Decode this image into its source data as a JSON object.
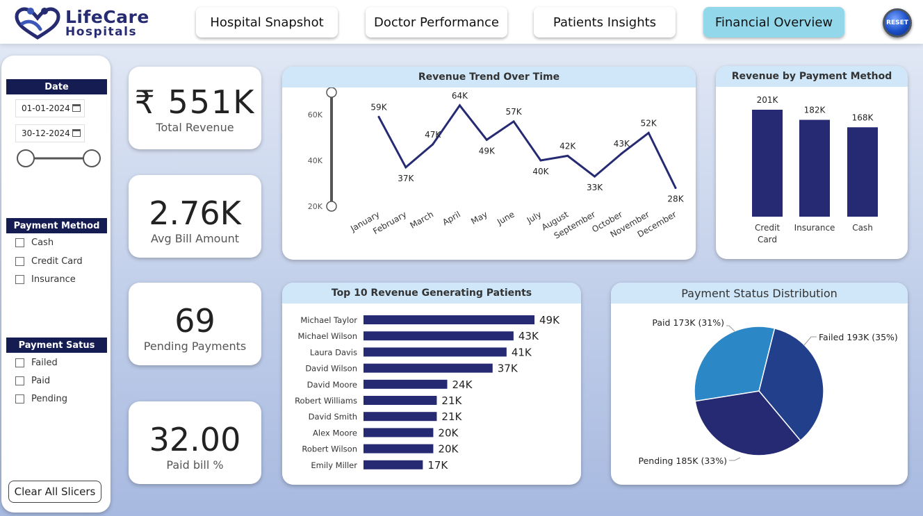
{
  "logo": {
    "line1": "LifeCare",
    "line2": "Hospitals"
  },
  "nav": [
    {
      "label": "Hospital Snapshot",
      "active": false
    },
    {
      "label": "Doctor Performance",
      "active": false
    },
    {
      "label": "Patients Insights",
      "active": false
    },
    {
      "label": "Financial Overview",
      "active": true
    }
  ],
  "reset_label": "RESET",
  "slicers": {
    "date": {
      "title": "Date",
      "start": "01-01-2024",
      "end": "30-12-2024"
    },
    "payment_method": {
      "title": "Payment Method",
      "options": [
        "Cash",
        "Credit Card",
        "Insurance"
      ]
    },
    "payment_status": {
      "title": "Payment Satus",
      "options": [
        "Failed",
        "Paid",
        "Pending"
      ]
    },
    "clear_label": "Clear All Slicers"
  },
  "kpis": [
    {
      "value": "₹ 551K",
      "label": "Total Revenue"
    },
    {
      "value": "2.76K",
      "label": "Avg Bill Amount"
    },
    {
      "value": "69",
      "label": "Pending Payments"
    },
    {
      "value": "32.00",
      "label": "Paid bill %"
    }
  ],
  "colors": {
    "navy": "#252a72",
    "slicer_header": "#141c52",
    "card_header": "#cfe7f8",
    "active_tab": "#93d8ea",
    "pie": [
      "#223f8c",
      "#252a72",
      "#2c87c6"
    ]
  },
  "chart_data": [
    {
      "type": "line",
      "title": "Revenue Trend Over Time",
      "categories": [
        "January",
        "February",
        "March",
        "April",
        "May",
        "June",
        "July",
        "August",
        "September",
        "October",
        "November",
        "December"
      ],
      "values": [
        59,
        37,
        47,
        64,
        49,
        57,
        40,
        42,
        33,
        43,
        52,
        28
      ],
      "labels": [
        "59K",
        "37K",
        "47K",
        "64K",
        "49K",
        "57K",
        "40K",
        "42K",
        "33K",
        "43K",
        "52K",
        "28K"
      ],
      "yticks": [
        "20K",
        "40K",
        "60K"
      ],
      "ylim": [
        20,
        64
      ]
    },
    {
      "type": "bar",
      "title": "Revenue by Payment Method",
      "categories": [
        "Credit Card",
        "Insurance",
        "Cash"
      ],
      "values": [
        201,
        182,
        168
      ],
      "labels": [
        "201K",
        "182K",
        "168K"
      ]
    },
    {
      "type": "bar",
      "orientation": "horizontal",
      "title": "Top 10 Revenue Generating Patients",
      "categories": [
        "Michael Taylor",
        "Michael Wilson",
        "Laura Davis",
        "David Wilson",
        "David Moore",
        "Robert Williams",
        "David Smith",
        "Alex Moore",
        "Robert Wilson",
        "Emily Miller"
      ],
      "values": [
        49,
        43,
        41,
        37,
        24,
        21,
        21,
        20,
        20,
        17
      ],
      "labels": [
        "49K",
        "43K",
        "41K",
        "37K",
        "24K",
        "21K",
        "21K",
        "20K",
        "20K",
        "17K"
      ]
    },
    {
      "type": "pie",
      "title": "Payment Status Distribution",
      "slices": [
        {
          "name": "Failed",
          "value": 193,
          "label": "Failed 193K (35%)"
        },
        {
          "name": "Pending",
          "value": 185,
          "label": "Pending 185K (33%)"
        },
        {
          "name": "Paid",
          "value": 173,
          "label": "Paid 173K (31%)"
        }
      ]
    }
  ]
}
